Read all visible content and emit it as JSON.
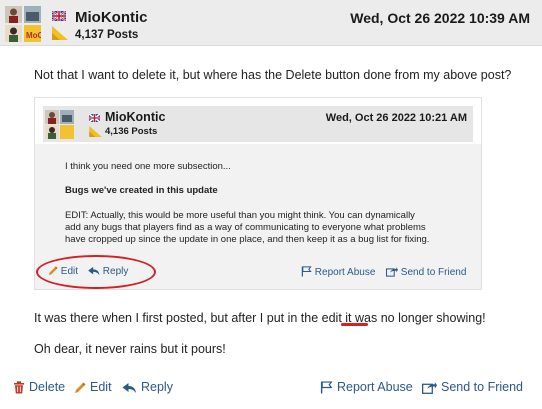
{
  "post": {
    "username": "MioKontic",
    "post_count": "4,137 Posts",
    "date": "Wed, Oct 26 2022 10:39 AM",
    "body": [
      "Not that I want to delete it, but where has the Delete button done from my above post?",
      "It was there when I first posted, but after I put in the edit it was no longer showing!",
      "Oh dear, it never rains but it pours!"
    ]
  },
  "quote": {
    "username": "MioKontic",
    "post_count": "4,136 Posts",
    "date": "Wed, Oct 26 2022 10:21 AM",
    "lines": [
      "I think you need one more subsection...",
      "Bugs we've created in this update",
      "EDIT:  Actually, this would be more useful than you might think.  You can dynamically",
      "add any bugs that players find as a way of communicating to everyone what problems",
      "have cropped up since the update in one place, and then keep it as a bug list for fixing."
    ],
    "actions": {
      "edit": "Edit",
      "reply": "Reply",
      "report": "Report Abuse",
      "send": "Send to Friend"
    }
  },
  "footer": {
    "delete": "Delete",
    "edit": "Edit",
    "reply": "Reply",
    "report": "Report Abuse",
    "send": "Send to Friend"
  },
  "colors": {
    "link": "#2a5a8a",
    "delete": "#c0392b",
    "edit_pencil": "#e08a1e",
    "annotation": "#d42020",
    "header_bg": "#ececec"
  },
  "icons": [
    "trash-icon",
    "pencil-icon",
    "reply-arrow-icon",
    "flag-icon",
    "share-icon",
    "uk-flag-icon",
    "rank-icon"
  ]
}
